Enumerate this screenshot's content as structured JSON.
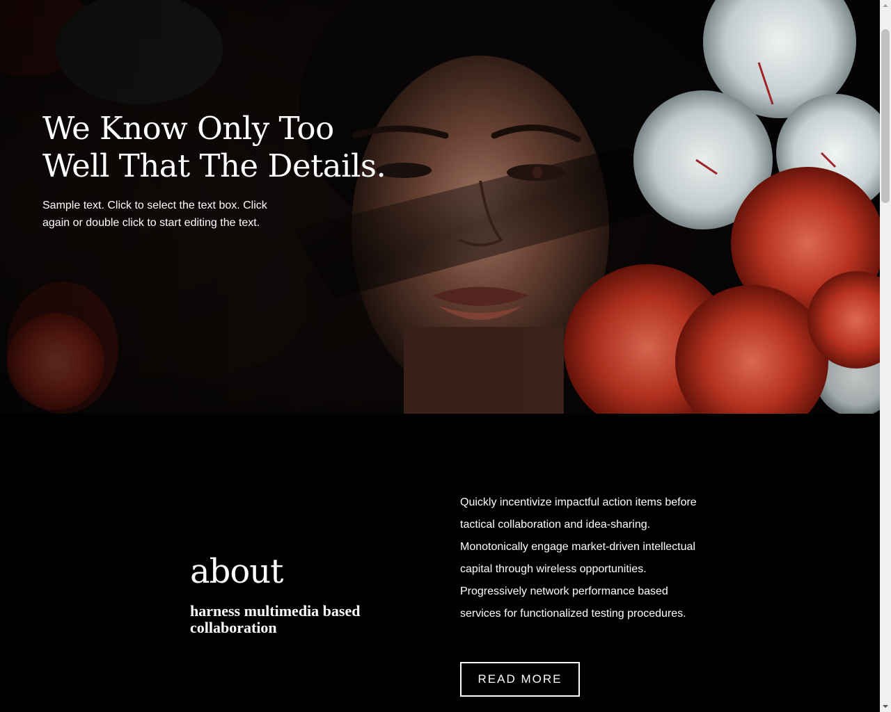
{
  "hero": {
    "title_line_1": "We Know Only Too",
    "title_line_2": "Well That The Details.",
    "text": "Sample text. Click to select the text box. Click again or double click to start editing the text."
  },
  "about": {
    "heading": "about",
    "subheading": "harness multimedia based collaboration",
    "body": "Quickly incentivize impactful action items before tactical collaboration and idea-sharing. Monotonically engage market-driven intellectual capital through wireless opportunities. Progressively network performance based services for functionalized testing procedures.",
    "button_label": "READ MORE"
  },
  "icons": {
    "scroll_up": "chevron-up-icon",
    "scroll_down": "chevron-down-icon"
  },
  "colors": {
    "background": "#000000",
    "text": "#ffffff",
    "flower_red": "#b8321f",
    "flower_white": "#dfe6e6"
  }
}
